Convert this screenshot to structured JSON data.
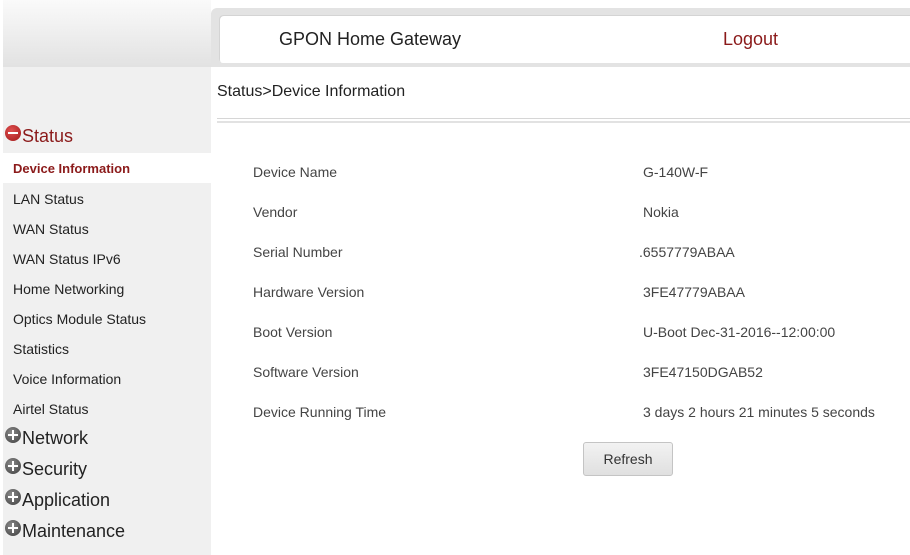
{
  "header": {
    "title": "GPON Home Gateway",
    "logout_label": "Logout"
  },
  "breadcrumb": "Status>Device Information",
  "sidebar": {
    "categories": [
      {
        "label": "Status",
        "icon": "collapse-minus-icon",
        "expanded": true
      },
      {
        "label": "Network",
        "icon": "expand-plus-icon",
        "expanded": false
      },
      {
        "label": "Security",
        "icon": "expand-plus-icon",
        "expanded": false
      },
      {
        "label": "Application",
        "icon": "expand-plus-icon",
        "expanded": false
      },
      {
        "label": "Maintenance",
        "icon": "expand-plus-icon",
        "expanded": false
      }
    ],
    "status_items": [
      {
        "label": "Device Information",
        "active": true
      },
      {
        "label": "LAN Status"
      },
      {
        "label": "WAN Status"
      },
      {
        "label": "WAN Status IPv6"
      },
      {
        "label": "Home Networking"
      },
      {
        "label": "Optics Module Status"
      },
      {
        "label": "Statistics"
      },
      {
        "label": "Voice Information"
      },
      {
        "label": "Airtel Status"
      }
    ]
  },
  "device_info": [
    {
      "label": "Device Name",
      "value": "G-140W-F"
    },
    {
      "label": "Vendor",
      "value": "Nokia"
    },
    {
      "label": "Serial Number",
      "value": ".6557779ABAA"
    },
    {
      "label": "Hardware Version",
      "value": "3FE47779ABAA"
    },
    {
      "label": "Boot Version",
      "value": "U-Boot Dec-31-2016--12:00:00"
    },
    {
      "label": "Software Version",
      "value": "3FE47150DGAB52"
    },
    {
      "label": "Device Running Time",
      "value": "3 days 2 hours 21 minutes 5 seconds"
    }
  ],
  "refresh_label": "Refresh",
  "colors": {
    "accent": "#8b1a1a",
    "sidebar_bg": "#f0f0f0",
    "header_bg": "#e3e3e3"
  }
}
